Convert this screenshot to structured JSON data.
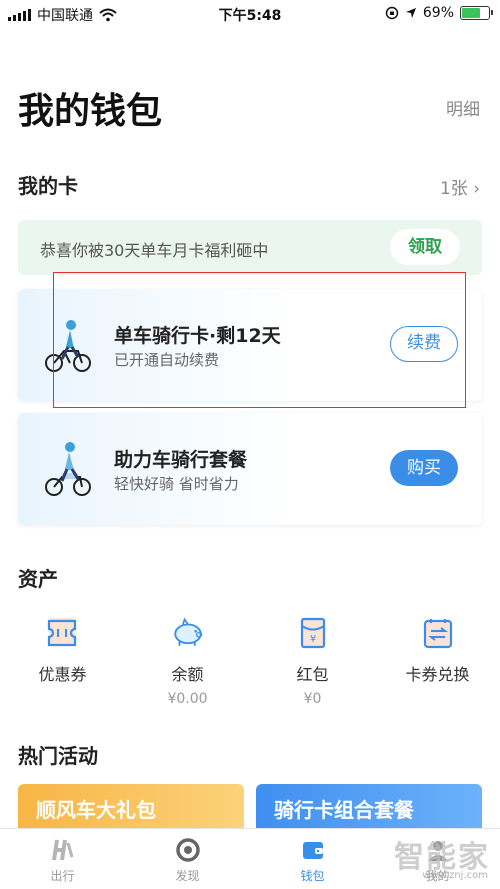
{
  "status_bar": {
    "carrier": "中国联通",
    "time": "下午5:48",
    "battery": "69%",
    "battery_level": 0.69
  },
  "header": {
    "title": "我的钱包",
    "detail_link": "明细"
  },
  "my_cards": {
    "title": "我的卡",
    "count": "1张 ›",
    "promo": {
      "text": "恭喜你被30天单车月卡福利砸中",
      "button": "领取"
    },
    "cards": [
      {
        "title": "单车骑行卡·剩12天",
        "subtitle": "已开通自动续费",
        "button": "续费"
      },
      {
        "title": "助力车骑行套餐",
        "subtitle": "轻快好骑 省时省力",
        "button": "购买"
      }
    ]
  },
  "assets": {
    "title": "资产",
    "items": [
      {
        "label": "优惠券",
        "value": "",
        "icon": "coupon-icon"
      },
      {
        "label": "余额",
        "value": "¥0.00",
        "icon": "piggy-bank-icon"
      },
      {
        "label": "红包",
        "value": "¥0",
        "icon": "red-envelope-icon"
      },
      {
        "label": "卡券兑换",
        "value": "",
        "icon": "exchange-icon"
      }
    ]
  },
  "hot_events": {
    "title": "热门活动",
    "items": [
      {
        "label": "顺风车大礼包"
      },
      {
        "label": "骑行卡组合套餐"
      }
    ]
  },
  "tabbar": {
    "items": [
      {
        "label": "出行",
        "icon": "h-logo-icon"
      },
      {
        "label": "发现",
        "icon": "discover-icon"
      },
      {
        "label": "钱包",
        "icon": "wallet-icon",
        "active": true
      },
      {
        "label": "我的",
        "icon": "profile-icon"
      }
    ]
  },
  "watermark": {
    "text": "智能家",
    "url": "www.znj.com"
  },
  "colors": {
    "accent": "#3b8ee8",
    "green": "#2fa150",
    "orange": "#f7b545",
    "highlight": "#e03030"
  }
}
